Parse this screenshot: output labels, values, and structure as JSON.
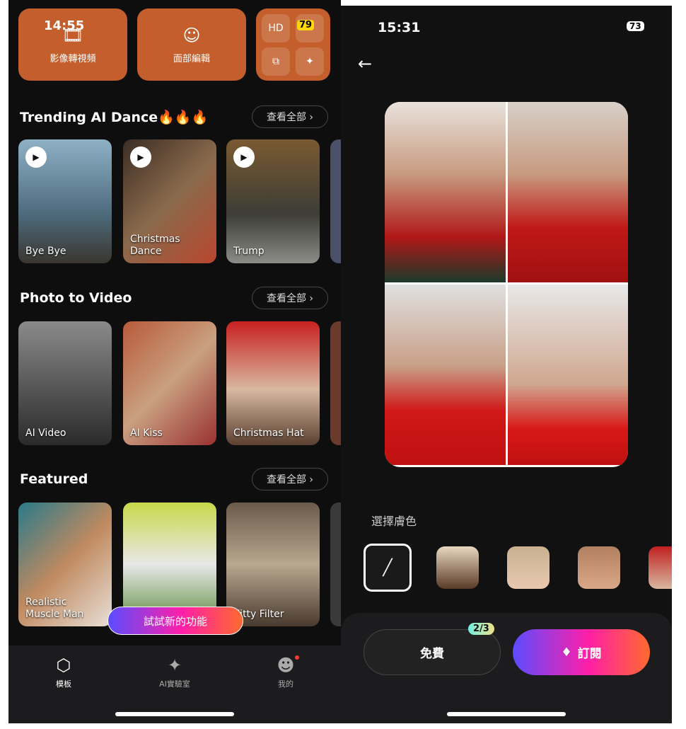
{
  "left": {
    "status": {
      "time": "14:55",
      "battery": "79"
    },
    "tools": [
      {
        "label": "影像轉視頻",
        "icon": "image-to-video-icon"
      },
      {
        "label": "面部編輯",
        "icon": "face-edit-icon"
      }
    ],
    "sections": [
      {
        "title": "Trending AI Dance🔥🔥🔥",
        "view_all": "查看全部 ›",
        "items": [
          "Bye Bye",
          "Christmas\nDance",
          "Trump"
        ]
      },
      {
        "title": "Photo to Video",
        "view_all": "查看全部 ›",
        "items": [
          "AI Video",
          "AI Kiss",
          "Christmas Hat"
        ]
      },
      {
        "title": "Featured",
        "view_all": "查看全部 ›",
        "items": [
          "Realistic\nMuscle Man",
          "",
          "Kitty Filter"
        ]
      }
    ],
    "tooltip": "試試新的功能",
    "nav": [
      {
        "label": "模板",
        "icon": "template-icon",
        "active": true
      },
      {
        "label": "AI實驗室",
        "icon": "ai-lab-icon"
      },
      {
        "label": "我的",
        "icon": "profile-icon",
        "badge": true
      }
    ]
  },
  "right": {
    "status": {
      "time": "15:31",
      "battery": "73"
    },
    "skin_label": "選擇膚色",
    "free_button": "免費",
    "free_badge": "2/3",
    "subscribe_button": "訂閱",
    "accent_gradient": [
      "#5b4cff",
      "#ff1fa8",
      "#ff6a2e"
    ]
  }
}
